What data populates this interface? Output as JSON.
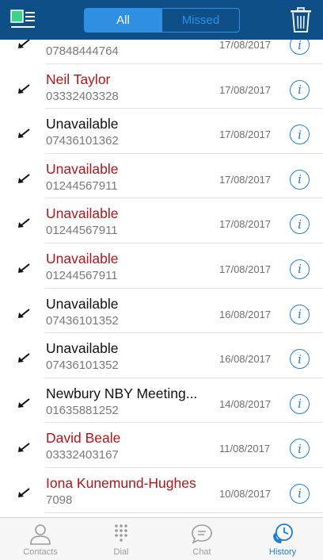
{
  "header": {
    "tabs": [
      {
        "label": "All",
        "active": true
      },
      {
        "label": "Missed",
        "active": false
      }
    ],
    "icons": {
      "menu": "menu-icon",
      "delete": "trash-icon"
    },
    "colors": {
      "bar": "#0d4f86",
      "accent": "#2f8fe0",
      "menu_green": "#3fd08a"
    }
  },
  "calls": [
    {
      "name": "",
      "number": "07848444764",
      "date": "17/08/2017",
      "missed": false
    },
    {
      "name": "Neil Taylor",
      "number": "03332403328",
      "date": "17/08/2017",
      "missed": true
    },
    {
      "name": "Unavailable",
      "number": "07436101362",
      "date": "17/08/2017",
      "missed": false
    },
    {
      "name": "Unavailable",
      "number": "01244567911",
      "date": "17/08/2017",
      "missed": true
    },
    {
      "name": "Unavailable",
      "number": "01244567911",
      "date": "17/08/2017",
      "missed": true
    },
    {
      "name": "Unavailable",
      "number": "01244567911",
      "date": "17/08/2017",
      "missed": true
    },
    {
      "name": "Unavailable",
      "number": "07436101352",
      "date": "16/08/2017",
      "missed": false
    },
    {
      "name": "Unavailable",
      "number": "07436101352",
      "date": "16/08/2017",
      "missed": false
    },
    {
      "name": "Newbury NBY Meeting...",
      "number": "01635881252",
      "date": "14/08/2017",
      "missed": false
    },
    {
      "name": "David Beale",
      "number": "03332403167",
      "date": "11/08/2017",
      "missed": true
    },
    {
      "name": "Iona Kunemund-Hughes",
      "number": "7098",
      "date": "10/08/2017",
      "missed": true
    }
  ],
  "colors": {
    "missed": "#b0161a",
    "normal": "#111111",
    "info": "#1f7fd0"
  },
  "tabbar": {
    "items": [
      {
        "label": "Contacts",
        "icon": "person-icon",
        "active": false
      },
      {
        "label": "Dial",
        "icon": "dialpad-icon",
        "active": false
      },
      {
        "label": "Chat",
        "icon": "chat-bubble-icon",
        "active": false
      },
      {
        "label": "History",
        "icon": "clock-phone-icon",
        "active": true
      }
    ]
  }
}
